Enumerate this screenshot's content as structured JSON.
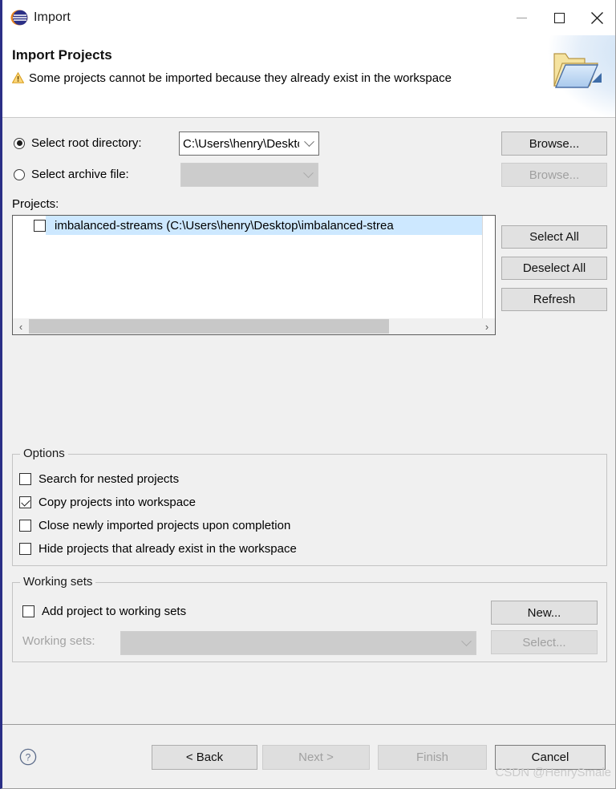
{
  "window": {
    "title": "Import",
    "logo_icon": "eclipse-logo-icon",
    "minimize_label": "—",
    "maximize_label": "☐",
    "close_label": "✕"
  },
  "header": {
    "title": "Import Projects",
    "warning_icon": "warning-triangle-icon",
    "warning_text": "Some projects cannot be imported because they already exist in the workspace",
    "banner_icon": "import-folder-icon"
  },
  "source": {
    "root_directory": {
      "label": "Select root directory:",
      "selected": true,
      "value": "C:\\Users\\henry\\Desktop\\imbalanced-strea",
      "browse_label": "Browse...",
      "browse_enabled": true
    },
    "archive_file": {
      "label": "Select archive file:",
      "selected": false,
      "value": "",
      "browse_label": "Browse...",
      "browse_enabled": false
    }
  },
  "projects": {
    "label": "Projects:",
    "rows": [
      {
        "name": "imbalanced-streams (C:\\Users\\henry\\Desktop\\imbalanced-strea",
        "checked": false,
        "selected": true
      }
    ],
    "buttons": [
      {
        "label": "Select All",
        "enabled": true
      },
      {
        "label": "Deselect All",
        "enabled": true
      },
      {
        "label": "Refresh",
        "enabled": true
      }
    ],
    "scroll": {
      "left_arrow": "‹",
      "right_arrow": "›",
      "thumb_percent": 80
    }
  },
  "options": {
    "title": "Options",
    "items": [
      {
        "label": "Search for nested projects",
        "checked": false
      },
      {
        "label": "Copy projects into workspace",
        "checked": true
      },
      {
        "label": "Close newly imported projects upon completion",
        "checked": false
      },
      {
        "label": "Hide projects that already exist in the workspace",
        "checked": false
      }
    ]
  },
  "working_sets": {
    "title": "Working sets",
    "add_checkbox": {
      "label": "Add project to working sets",
      "checked": false
    },
    "new_button": {
      "label": "New...",
      "enabled": true
    },
    "combo_label": "Working sets:",
    "combo_value": "",
    "combo_enabled": false,
    "select_button": {
      "label": "Select...",
      "enabled": false
    }
  },
  "footer": {
    "help_icon": "help-question-icon",
    "buttons": [
      {
        "label": "< Back",
        "enabled": true,
        "default": false
      },
      {
        "label": "Next >",
        "enabled": false,
        "default": false
      },
      {
        "label": "Finish",
        "enabled": false,
        "default": false
      },
      {
        "label": "Cancel",
        "enabled": true,
        "default": true
      }
    ]
  },
  "watermark": "CSDN @HenrySmale",
  "colors": {
    "accent": "#2b2f86",
    "selection": "#cde8ff",
    "dialog_bg": "#f0f0f0",
    "warning": "#e8a31a"
  }
}
